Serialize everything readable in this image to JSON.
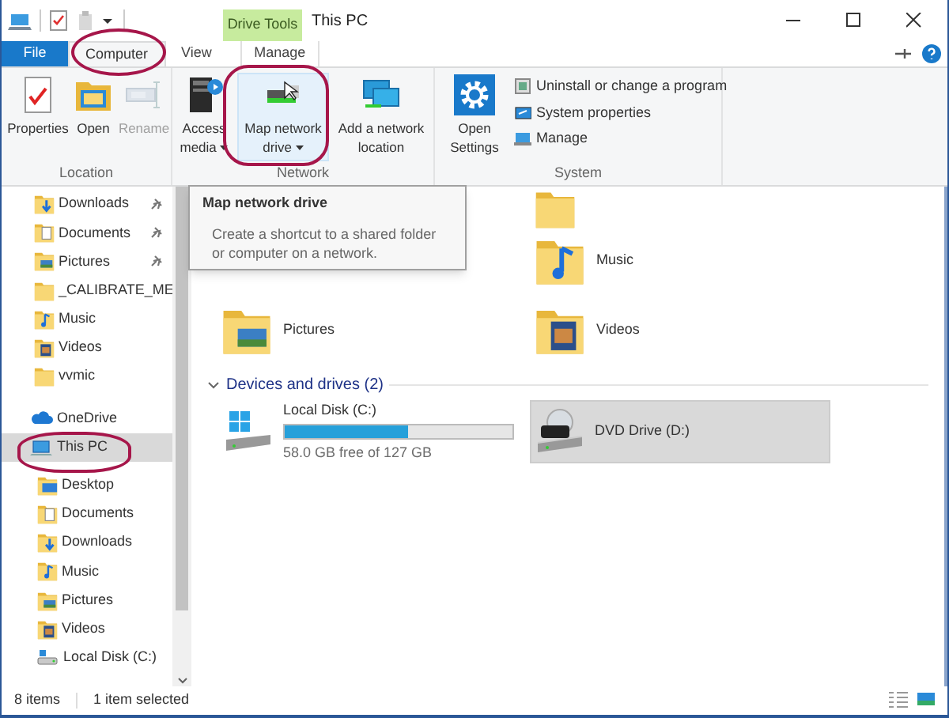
{
  "window": {
    "title": "This PC",
    "context_group": "Drive Tools"
  },
  "ribbon_tabs": [
    {
      "label": "File",
      "kind": "file",
      "selected": false
    },
    {
      "label": "Computer",
      "kind": "tab",
      "selected": true
    },
    {
      "label": "View",
      "kind": "tab",
      "selected": false
    },
    {
      "label": "Manage",
      "kind": "context",
      "selected": false
    }
  ],
  "ribbon_groups": [
    {
      "label": "Location",
      "buttons": [
        {
          "label": "Properties",
          "kind": "properties",
          "dropdown": false,
          "disabled": false,
          "hovered": false
        },
        {
          "label": "Open",
          "kind": "open",
          "dropdown": false,
          "disabled": false,
          "hovered": false
        },
        {
          "label": "Rename",
          "kind": "rename",
          "dropdown": false,
          "disabled": true,
          "hovered": false
        }
      ]
    },
    {
      "label": "Network",
      "buttons": [
        {
          "label": "Access media",
          "kind": "media",
          "dropdown": true,
          "disabled": false,
          "hovered": false
        },
        {
          "label": "Map network drive",
          "kind": "map",
          "dropdown": true,
          "disabled": false,
          "hovered": true
        },
        {
          "label": "Add a network location",
          "kind": "netloc",
          "dropdown": false,
          "disabled": false,
          "hovered": false
        }
      ]
    },
    {
      "label": "System",
      "buttons": [
        {
          "label": "Open Settings",
          "kind": "settings",
          "dropdown": false,
          "disabled": false,
          "hovered": false
        }
      ],
      "small_buttons": [
        {
          "label": "Uninstall or change a program"
        },
        {
          "label": "System properties"
        },
        {
          "label": "Manage"
        }
      ]
    }
  ],
  "tooltip": {
    "title": "Map network drive",
    "text": "Create a shortcut to a shared folder or computer on a network."
  },
  "sidebar": {
    "quick_access": [
      {
        "label": "Downloads",
        "kind": "downloads",
        "pinned": true
      },
      {
        "label": "Documents",
        "kind": "documents",
        "pinned": true
      },
      {
        "label": "Pictures",
        "kind": "pictures",
        "pinned": true
      },
      {
        "label": "_CALIBRATE_ME",
        "kind": "folder",
        "pinned": false
      },
      {
        "label": "Music",
        "kind": "music",
        "pinned": false
      },
      {
        "label": "Videos",
        "kind": "videos",
        "pinned": false
      },
      {
        "label": "vvmic",
        "kind": "folder",
        "pinned": false
      }
    ],
    "locations": [
      {
        "label": "OneDrive",
        "kind": "cloud",
        "selected": false
      },
      {
        "label": "This PC",
        "kind": "pc",
        "selected": true,
        "children": [
          {
            "label": "Desktop",
            "kind": "desktop"
          },
          {
            "label": "Documents",
            "kind": "documents"
          },
          {
            "label": "Downloads",
            "kind": "downloads"
          },
          {
            "label": "Music",
            "kind": "music"
          },
          {
            "label": "Pictures",
            "kind": "pictures"
          },
          {
            "label": "Videos",
            "kind": "videos"
          },
          {
            "label": "Local Disk (C:)",
            "kind": "disk"
          }
        ]
      }
    ]
  },
  "folders": [
    {
      "label": "Music",
      "kind": "music"
    },
    {
      "label": "Pictures",
      "kind": "pictures"
    },
    {
      "label": "Videos",
      "kind": "videos"
    }
  ],
  "devices_header": "Devices and drives (2)",
  "drives": [
    {
      "label": "Local Disk (C:)",
      "kind": "hdd",
      "level": 0.54,
      "reading": "58.0 GB free of 127 GB",
      "selected": false
    },
    {
      "label": "DVD Drive (D:)",
      "kind": "dvd",
      "selected": true
    }
  ],
  "status_bar": [
    "8 items",
    "1 item selected"
  ]
}
